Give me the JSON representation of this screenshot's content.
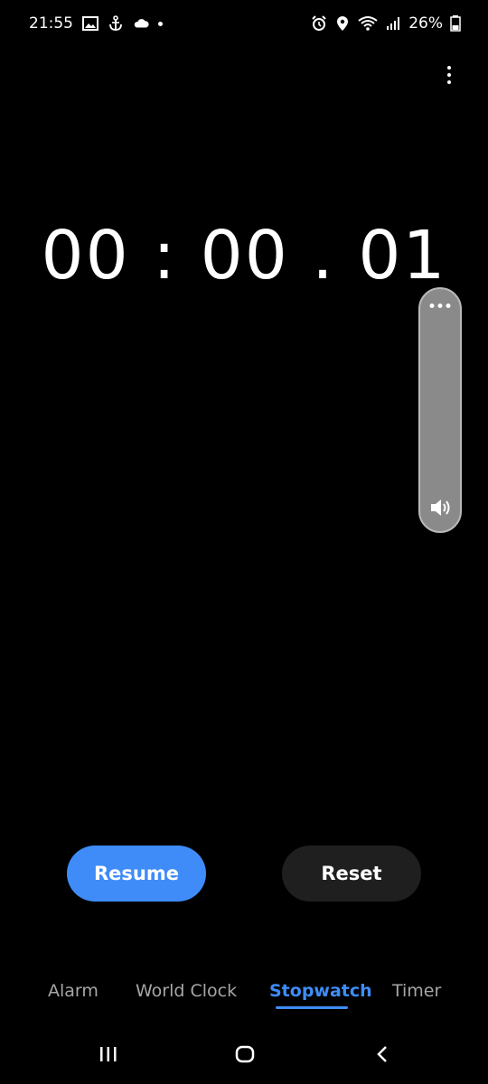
{
  "status_bar": {
    "time": "21:55",
    "battery": "26%",
    "left_icons": [
      "image-icon",
      "anchor-icon",
      "cloud-icon",
      "dot-icon"
    ],
    "right_icons": [
      "alarm-icon",
      "location-icon",
      "wifi-icon",
      "signal-icon",
      "battery-icon"
    ]
  },
  "stopwatch": {
    "time": "00 : 00 . 01"
  },
  "volume_panel": {
    "top_icon": "more-dots-icon",
    "bottom_icon": "speaker-icon"
  },
  "buttons": {
    "resume_label": "Resume",
    "reset_label": "Reset"
  },
  "tabs": {
    "items": [
      {
        "label": "Alarm",
        "active": false
      },
      {
        "label": "World Clock",
        "active": false
      },
      {
        "label": "Stopwatch",
        "active": true
      },
      {
        "label": "Timer",
        "active": false
      }
    ]
  },
  "nav_bar": {
    "icons": [
      "recents-icon",
      "home-icon",
      "back-icon"
    ]
  },
  "colors": {
    "accent": "#3f8cf8",
    "background": "#000000",
    "secondary_button": "#1f1f1f",
    "inactive_tab": "#a6a6a6"
  }
}
